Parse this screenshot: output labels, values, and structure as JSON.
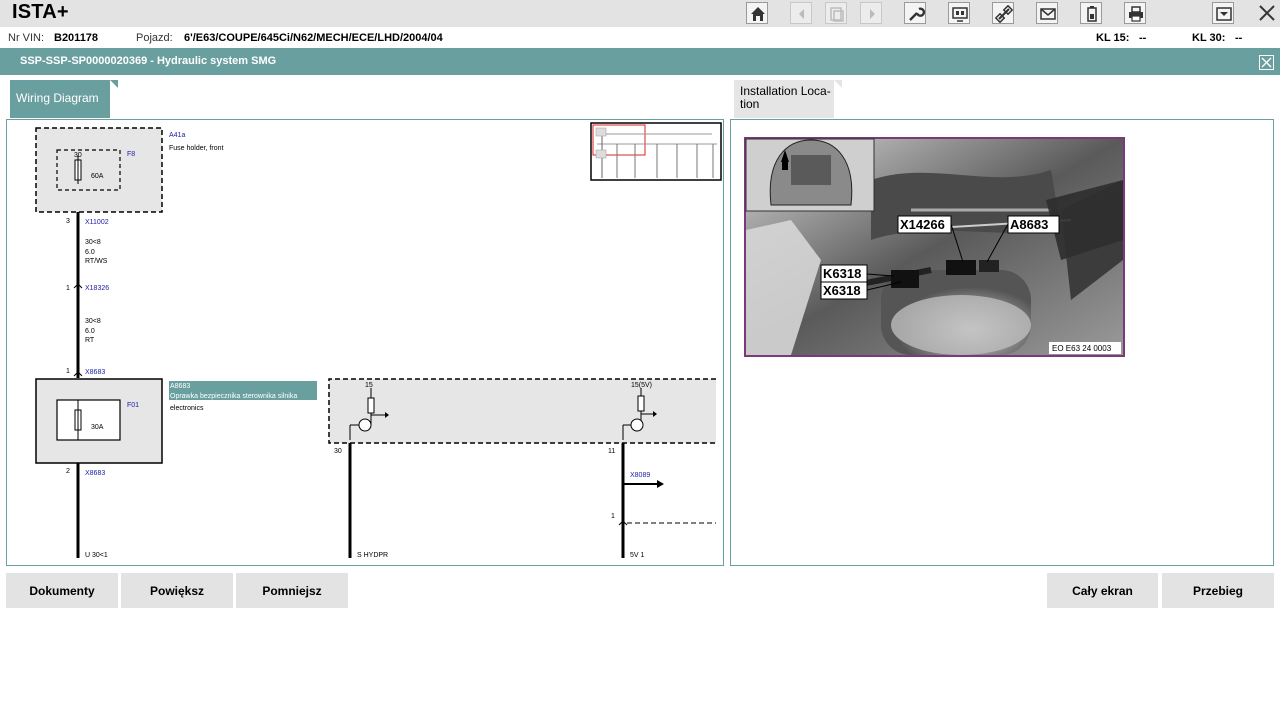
{
  "app": {
    "title": "ISTA+"
  },
  "toolbar": {
    "icons": [
      "home-icon",
      "back-icon",
      "print-preview-icon",
      "forward-icon",
      "wrench-icon",
      "vehicle-test-icon",
      "connection-icon",
      "mail-icon",
      "battery-icon",
      "print-icon",
      "dropdown-icon",
      "close-icon"
    ]
  },
  "vehicle": {
    "vin_label": "Nr VIN:",
    "vin": "B201178",
    "vehicle_label": "Pojazd:",
    "vehicle": "6'/E63/COUPE/645Ci/N62/MECH/ECE/LHD/2004/04",
    "kl15_label": "KL 15:",
    "kl15": "--",
    "kl30_label": "KL 30:",
    "kl30": "--"
  },
  "header": {
    "title": "SSP-SSP-SP0000020369  -  Hydraulic system SMG"
  },
  "tabs": {
    "wiring": "Wiring Diagram",
    "install": "Installation Loca-tion"
  },
  "diagram": {
    "comp1_id": "A41a",
    "comp1_desc": "Fuse holder, front",
    "fuse1_id": "F8",
    "fuse1_pin": "30",
    "fuse1_rating": "60A",
    "pin_3": "3",
    "conn1": "X11002",
    "wire1_a": "30<8",
    "wire1_b": "6.0",
    "wire1_c": "RT/WS",
    "pin_1a": "1",
    "conn2": "X18326",
    "wire2_a": "30<8",
    "wire2_b": "6.0",
    "wire2_c": "RT",
    "pin_1b": "1",
    "conn3": "X8683",
    "comp2_id": "A8683",
    "comp2_desc": "Oprawka bezpiecznika sterownika silnika",
    "comp2_desc2": "electronics",
    "fuse2_id": "F01",
    "fuse2_rating": "30A",
    "pin_2": "2",
    "conn4": "X8683",
    "bottom1": "U  30<1",
    "trans1_label": "15",
    "pin_30": "30",
    "bottom2": "S  HYDPR",
    "trans2_label": "15(5V)",
    "pin_11": "11",
    "conn5": "X8089",
    "pin_1c": "1",
    "bottom3": "5V  1"
  },
  "photo": {
    "labels": [
      "X14266",
      "A8683",
      "K6318",
      "X6318"
    ],
    "caption": "EO E63 24 0003"
  },
  "buttons": {
    "documents": "Dokumenty",
    "zoom_in": "Powiększ",
    "zoom_out": "Pomniejsz",
    "fullscreen": "Cały ekran",
    "sequence": "Przebieg"
  },
  "colors": {
    "accent": "#6a9fa0",
    "link": "#1a1aa6",
    "highlight": "#7a3a7a"
  }
}
